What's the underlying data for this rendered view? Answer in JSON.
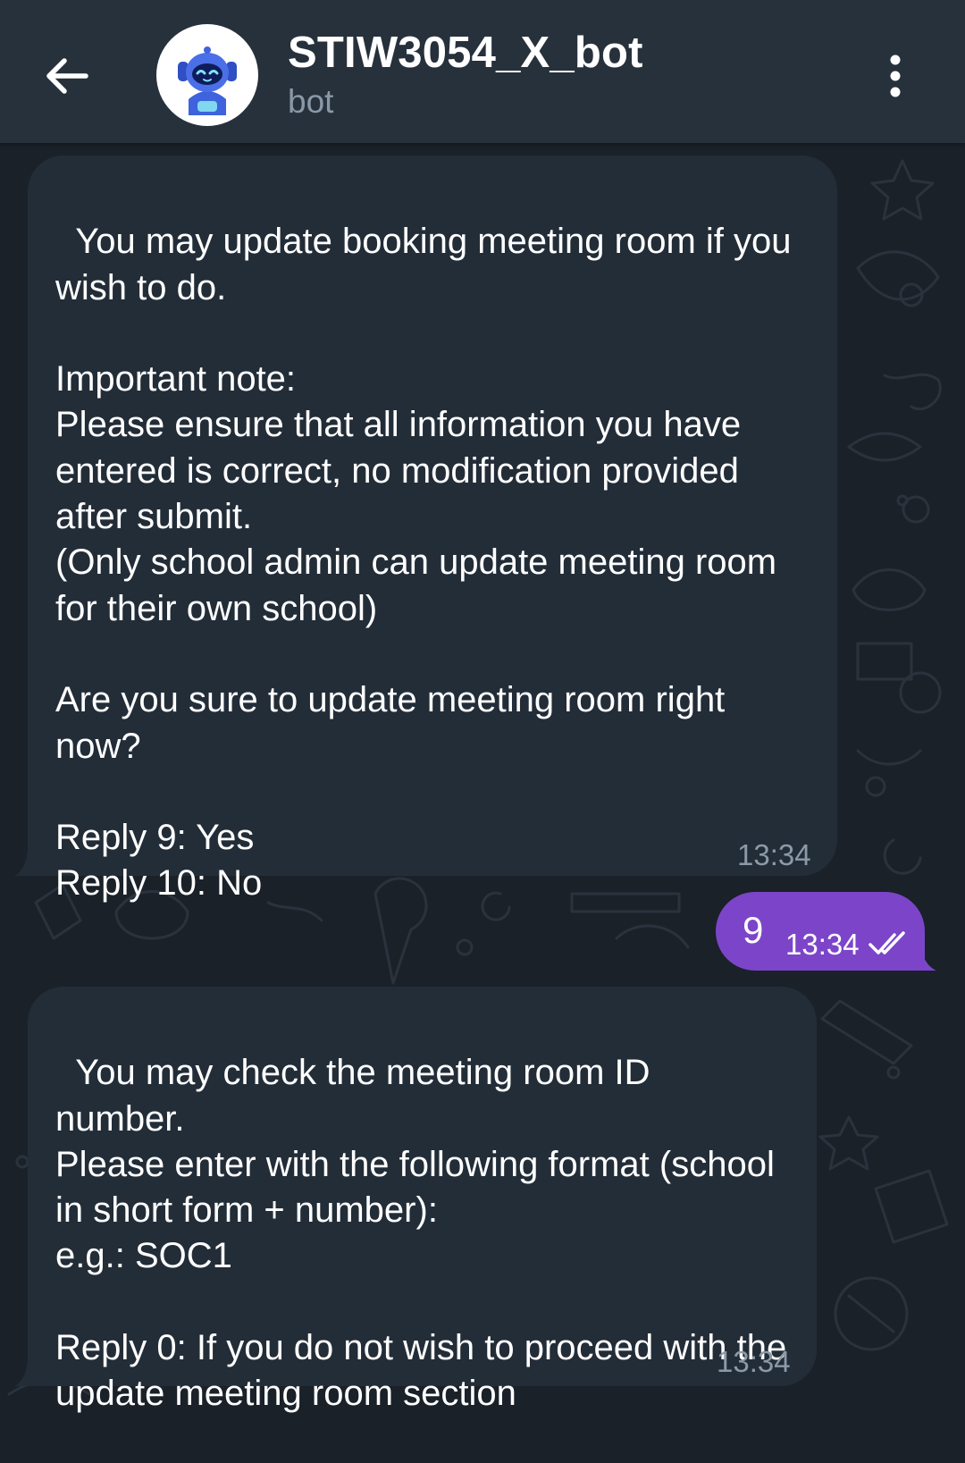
{
  "header": {
    "title": "STIW3054_X_bot",
    "subtitle": "bot",
    "back_icon": "arrow-left-icon",
    "menu_icon": "more-vertical-icon",
    "avatar_icon": "robot-avatar-icon"
  },
  "messages": [
    {
      "direction": "incoming",
      "text": "You may update booking meeting room if you wish to do.\n\nImportant note:\nPlease ensure that all information you have entered is correct, no modification provided after submit.\n(Only school admin can update meeting room for their own school)\n\nAre you sure to update meeting room right now?\n\nReply 9: Yes\nReply 10: No",
      "time": "13:34"
    },
    {
      "direction": "outgoing",
      "text": "9",
      "time": "13:34",
      "status_icon": "double-check-icon"
    },
    {
      "direction": "incoming",
      "text": "You may check the meeting room ID number.\nPlease enter with the following format (school in short form + number):\ne.g.: SOC1\n\nReply 0: If you do not wish to proceed with the update meeting room section",
      "time": "13:34"
    }
  ],
  "colors": {
    "background": "#1a2129",
    "header": "#27313c",
    "incoming_bubble": "#232d38",
    "outgoing_bubble": "#7c45c9",
    "subtitle": "#8a99a8"
  }
}
